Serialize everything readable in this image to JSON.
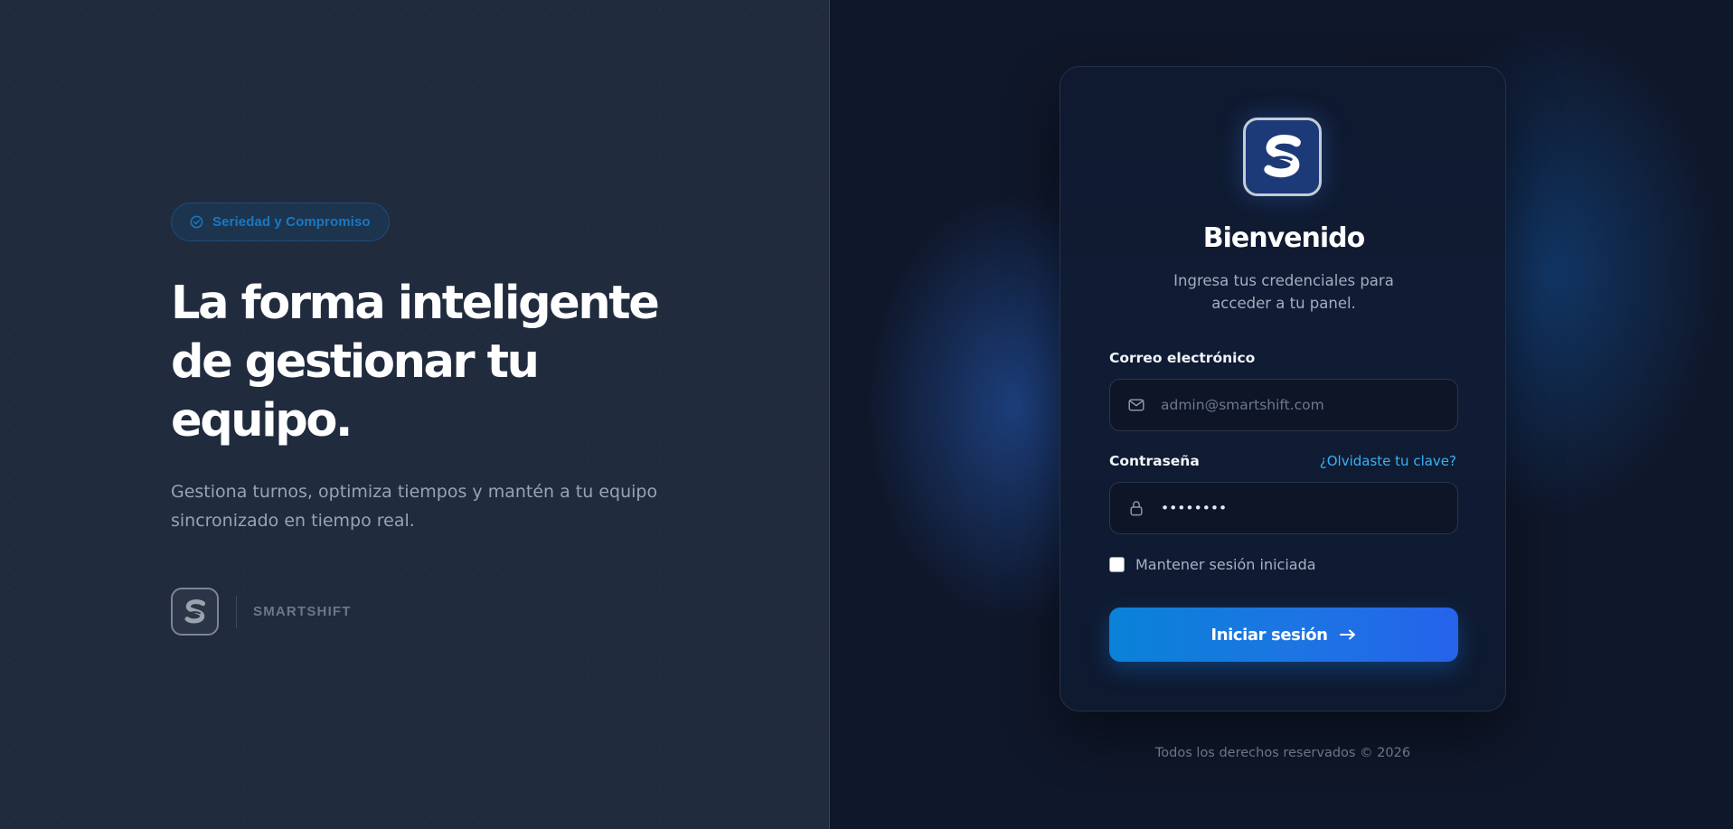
{
  "left_panel": {
    "badge": {
      "label": "Seriedad y Compromiso",
      "icon": "check-circle-icon"
    },
    "headline_lines": [
      "La forma inteligente",
      "de gestionar tu",
      "equipo."
    ],
    "lead_lines": [
      "Gestiona turnos, optimiza tiempos y mantén a tu equipo",
      "sincronizado en tiempo real."
    ],
    "brand": {
      "name": "SMARTSHIFT",
      "logo_icon": "smartshift-logo-icon"
    }
  },
  "login_card": {
    "logo_icon": "smartshift-logo-icon",
    "title": "Bienvenido",
    "subtitle_lines": [
      "Ingresa tus credenciales para",
      "acceder a tu panel."
    ],
    "email": {
      "label": "Correo electrónico",
      "placeholder": "admin@smartshift.com",
      "value": "",
      "icon": "mail-icon"
    },
    "password": {
      "label": "Contraseña",
      "forgot_link": "¿Olvidaste tu clave?",
      "value": "••••••••",
      "icon": "lock-icon"
    },
    "remember": {
      "label": "Mantener sesión iniciada",
      "checked": false
    },
    "submit": {
      "label": "Iniciar sesión",
      "icon": "arrow-right-icon"
    }
  },
  "footer": {
    "copyright": "Todos los derechos reservados © 2026"
  },
  "colors": {
    "left_bg": "#202b3e",
    "right_bg": "#0f172a",
    "accent": "#38b3f5",
    "button_start": "#0a82d8",
    "button_end": "#2563eb",
    "badge_text": "#1779c5"
  }
}
